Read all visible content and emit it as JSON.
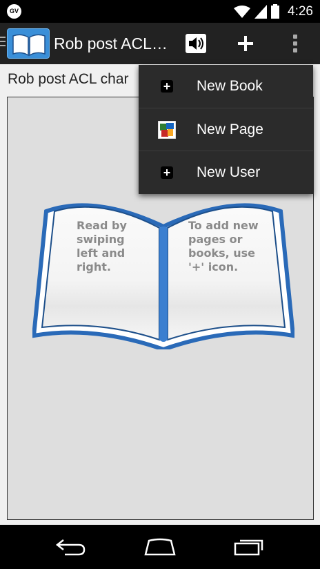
{
  "status_bar": {
    "left_badge": "GV",
    "time": "4:26",
    "icons": [
      "wifi-icon",
      "signal-icon",
      "battery-icon"
    ]
  },
  "action_bar": {
    "title": "Rob post ACL…",
    "icons": [
      "app-book-logo-icon",
      "speaker-icon",
      "plus-icon",
      "overflow-menu-icon"
    ]
  },
  "content": {
    "heading": "Rob post ACL char",
    "book": {
      "left_page_text": "Read by\nswiping\nleft and\nright.",
      "right_page_text": "To add new\npages or\nbooks, use\n'+' icon."
    }
  },
  "overflow_menu": {
    "items": [
      {
        "label": "New Book",
        "icon": "plus-box-icon"
      },
      {
        "label": "New Page",
        "icon": "photo-icon"
      },
      {
        "label": "New User",
        "icon": "plus-box-icon"
      }
    ]
  },
  "nav_bar": {
    "icons": [
      "back-icon",
      "home-icon",
      "recent-apps-icon"
    ]
  },
  "colors": {
    "action_bar": "#222222",
    "menu_bg": "#2b2b2b",
    "book_blue": "#2a6ab8",
    "frame_bg": "#dedede"
  }
}
